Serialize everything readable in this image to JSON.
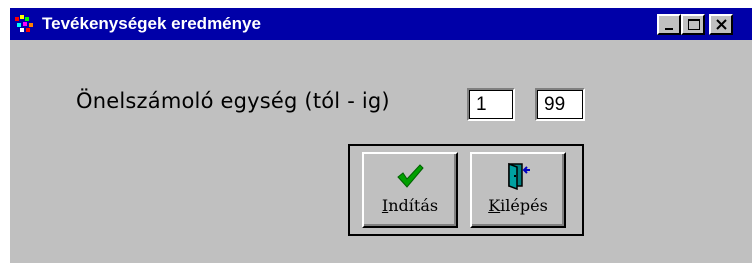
{
  "window": {
    "title": "Tevékenységek eredménye",
    "icon": "app-icon",
    "controls": [
      "minimize-icon",
      "maximize-icon",
      "close-icon"
    ],
    "titlebar_color": "#0000a8",
    "face_color": "#c0c0c0"
  },
  "form": {
    "label": "Önelszámoló egység (tól - ig)",
    "from_value": "1",
    "to_value": "99"
  },
  "buttons": {
    "start": {
      "label_mnemonic": "I",
      "label_rest": "ndítás",
      "icon": "checkmark-icon"
    },
    "exit": {
      "label_mnemonic": "K",
      "label_rest": "ilépés",
      "icon": "exit-door-icon"
    }
  }
}
